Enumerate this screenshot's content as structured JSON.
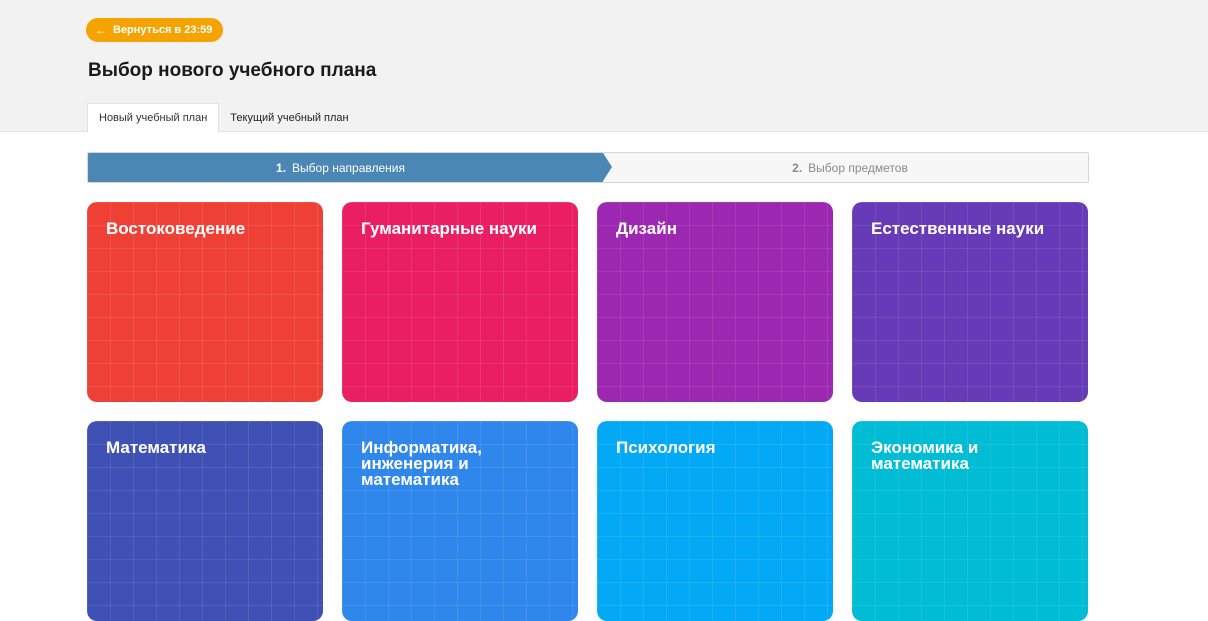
{
  "header": {
    "back_label": "Вернуться в 23:59",
    "title": "Выбор нового учебного плана",
    "tabs": [
      {
        "label": "Новый учебный план",
        "active": true
      },
      {
        "label": "Текущий учебный план",
        "active": false
      }
    ]
  },
  "stepper": {
    "steps": [
      {
        "number": "1.",
        "label": "Выбор направления",
        "active": true
      },
      {
        "number": "2.",
        "label": "Выбор предметов",
        "active": false
      }
    ]
  },
  "directions": [
    {
      "label": "Востоковедение",
      "color": "#ef4036"
    },
    {
      "label": "Гуманитарные науки",
      "color": "#e91e63"
    },
    {
      "label": "Дизайн",
      "color": "#9c27b0"
    },
    {
      "label": "Естественные науки",
      "color": "#673ab7"
    },
    {
      "label": "Математика",
      "color": "#3f51b5"
    },
    {
      "label": "Информатика,\nинженерия и\nматематика",
      "color": "#2f86eb"
    },
    {
      "label": "Психология",
      "color": "#03a9f4"
    },
    {
      "label": "Экономика и\nматематика",
      "color": "#00bcd4"
    }
  ]
}
